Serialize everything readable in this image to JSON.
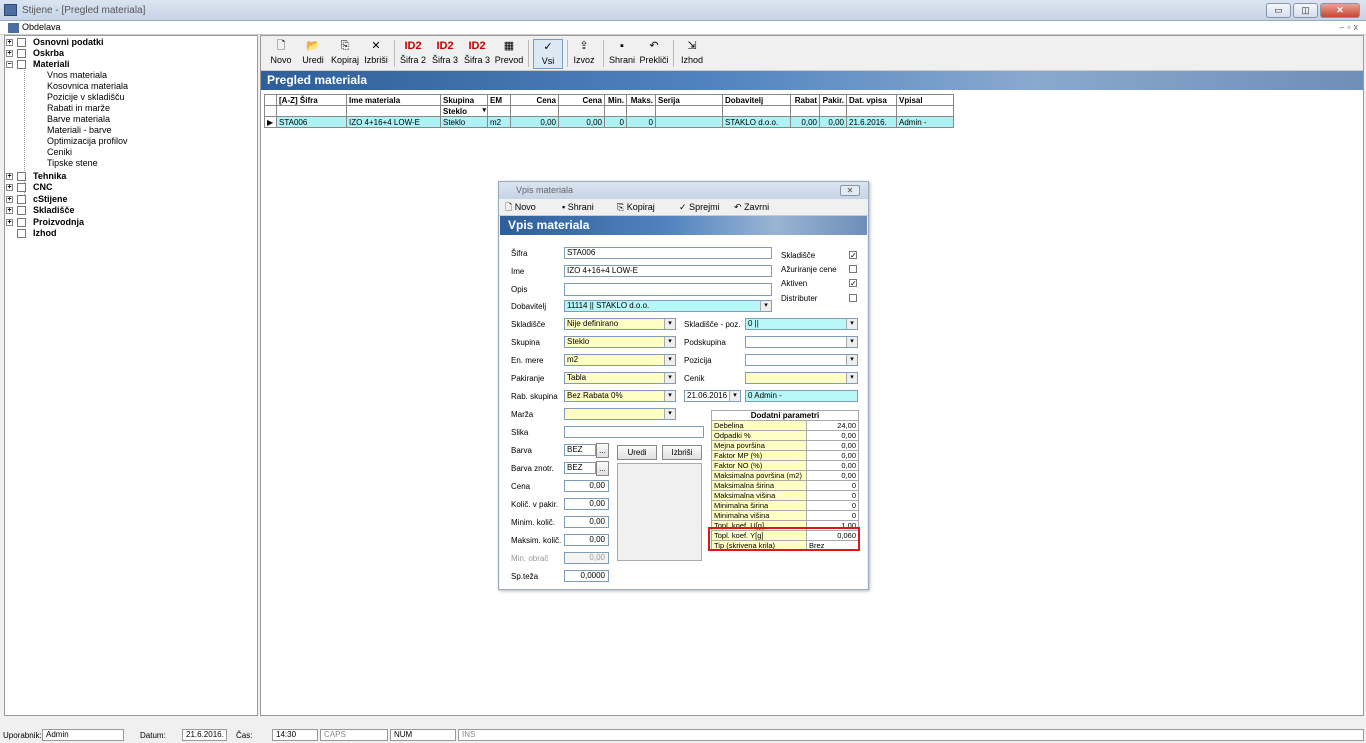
{
  "window": {
    "title": "Stijene - [Pregled materiala]",
    "min": "▭",
    "max": "◫",
    "close": "✕"
  },
  "menu": {
    "item": "Obdelava",
    "mdi_min": "–",
    "mdi_max": "▫",
    "mdi_close": "x"
  },
  "tree": {
    "top": [
      {
        "label": "Osnovni podatki",
        "expander": "+"
      },
      {
        "label": "Oskrba",
        "expander": "+"
      },
      {
        "label": "Materiali",
        "expander": "−"
      }
    ],
    "children": [
      "Vnos materiala",
      "Kosovnica materiala",
      "Pozicije v skladišču",
      "Rabati in marže",
      "Barve materiala",
      "Materiali - barve",
      "Optimizacija profilov",
      "Ceniki",
      "Tipske stene"
    ],
    "bottom": [
      {
        "label": "Tehnika",
        "expander": "+"
      },
      {
        "label": "CNC",
        "expander": "+"
      },
      {
        "label": "cStijene",
        "expander": "+"
      },
      {
        "label": "Skladišče",
        "expander": "+"
      },
      {
        "label": "Proizvodnja",
        "expander": "+"
      },
      {
        "label": "Izhod",
        "expander": ""
      }
    ]
  },
  "toolbar": [
    {
      "label": "Novo",
      "icon": "new-doc-icon",
      "glyph": "🗋"
    },
    {
      "label": "Uredi",
      "icon": "folder-edit-icon",
      "glyph": "📂"
    },
    {
      "label": "Kopiraj",
      "icon": "copy-icon",
      "glyph": "⎘"
    },
    {
      "label": "Izbriši",
      "icon": "delete-icon",
      "glyph": "✕"
    },
    {
      "label": "Šifra 2",
      "icon": "id2-icon",
      "glyph": "ID2"
    },
    {
      "label": "Šifra 3",
      "icon": "id2-icon",
      "glyph": "ID2"
    },
    {
      "label": "Šifra 3",
      "icon": "id2-icon",
      "glyph": "ID2"
    },
    {
      "label": "Prevod",
      "icon": "grid-icon",
      "glyph": "▦"
    },
    {
      "label": "Vsi",
      "icon": "checkmark-icon",
      "glyph": "✓"
    },
    {
      "label": "Izvoz",
      "icon": "export-icon",
      "glyph": "⇪"
    },
    {
      "label": "Shrani",
      "icon": "save-icon",
      "glyph": "▪"
    },
    {
      "label": "Prekliči",
      "icon": "undo-icon",
      "glyph": "↶"
    },
    {
      "label": "Izhod",
      "icon": "exit-icon",
      "glyph": "⇲"
    }
  ],
  "banner": "Pregled materiala",
  "grid": {
    "headers": [
      "[A-Z] Šifra",
      "Ime materiala",
      "Skupina",
      "EM",
      "Cena",
      "Cena",
      "Min.",
      "Maks.",
      "Serija",
      "Dobavitelj",
      "Rabat",
      "Pakir.",
      "Dat. vpisa",
      "Vpisal"
    ],
    "filter": {
      "skupina": "Steklo"
    },
    "row": [
      "STA006",
      "IZO 4+16+4 LOW-E",
      "Steklo",
      "m2",
      "0,00",
      "0,00",
      "0",
      "0",
      "",
      "STAKLO d.o.o.",
      "0,00",
      "0,00",
      "21.6.2016.",
      "Admin -"
    ],
    "indicator": "▶"
  },
  "dialog": {
    "title": "Vpis materiala",
    "close": "✕",
    "toolbar": [
      {
        "label": "Novo",
        "icon": "new-doc-icon",
        "glyph": "🗋"
      },
      {
        "label": "Shrani",
        "icon": "save-icon",
        "glyph": "▪"
      },
      {
        "label": "Kopiraj",
        "icon": "copy-icon",
        "glyph": "⎘"
      },
      {
        "label": "Sprejmi",
        "icon": "checkmark-icon",
        "glyph": "✓"
      },
      {
        "label": "Zavrni",
        "icon": "undo-icon",
        "glyph": "↶"
      }
    ],
    "banner": "Vpis materiala",
    "labels": {
      "sifra": "Šifra",
      "ime": "Ime",
      "opis": "Opis",
      "dobavitelj": "Dobavitelj",
      "skladisce": "Skladišče",
      "skupina": "Skupina",
      "enmere": "En. mere",
      "pakiranje": "Pakiranje",
      "rabsk": "Rab. skupina",
      "marza": "Marža",
      "slika": "Slika",
      "barva": "Barva",
      "barvaznotr": "Barva znotr.",
      "cena": "Cena",
      "kolicpakir": "Količ. v pakir.",
      "minkol": "Minim. količ.",
      "makskol": "Maksim. količ.",
      "minobr": "Min. obrač",
      "spteza": "Sp.teža",
      "sklpoz": "Skladišče - poz.",
      "podskupina": "Podskupina",
      "pozicija": "Pozicija",
      "cenik": "Cenik"
    },
    "values": {
      "sifra": "STA006",
      "ime": "IZO 4+16+4 LOW-E",
      "opis": "",
      "dobavitelj": "11114 || STAKLO d.o.o.",
      "skladisce": "Nije definirano",
      "skupina": "Steklo",
      "enmere": "m2",
      "pakiranje": "Tabla",
      "rabsk": "Bez Rabata 0%",
      "marza": "",
      "slika": "",
      "barva": "BEZ",
      "barvaznotr": "BEZ",
      "cena": "0,00",
      "kolicpakir": "0,00",
      "minkol": "0,00",
      "makskol": "0,00",
      "minobr": "0,00",
      "spteza": "0,0000",
      "sklpoz": "0 ||",
      "podskupina": "",
      "pozicija": "",
      "cenik": "",
      "datum": "21.06.2016",
      "vpisal": "0 Admin -"
    },
    "checks": [
      {
        "label": "Skladišče",
        "checked": "✓"
      },
      {
        "label": "Ažuriranje cene",
        "checked": ""
      },
      {
        "label": "Aktiven",
        "checked": "✓"
      },
      {
        "label": "Distributer",
        "checked": ""
      }
    ],
    "buttons": {
      "uredi": "Uredi",
      "izbrisi": "Izbriši",
      "ellipsis": "..."
    },
    "params": {
      "title": "Dodatni parametri",
      "rows": [
        [
          "Debelina",
          "24,00"
        ],
        [
          "Odpadki %",
          "0,00"
        ],
        [
          "Mejna površina",
          "0,00"
        ],
        [
          "Faktor MP (%)",
          "0,00"
        ],
        [
          "Faktor NO (%)",
          "0,00"
        ],
        [
          "Maksimalna površina (m2)",
          "0,00"
        ],
        [
          "Maksimalna širina",
          "0"
        ],
        [
          "Maksimalna višina",
          "0"
        ],
        [
          "Minimalna širina",
          "0"
        ],
        [
          "Minimalna višina",
          "0"
        ],
        [
          "Topl. koef. U[g]",
          "1,00"
        ],
        [
          "Topl. koef. Y[g]",
          "0,060"
        ],
        [
          "Tip (skrivena krila)",
          "Brez"
        ]
      ]
    }
  },
  "status": {
    "user_label": "Uporabnik:",
    "user": "Admin",
    "date_label": "Datum:",
    "date": "21.6.2016.",
    "time_label": "Čas:",
    "time": "14:30",
    "caps": "CAPS",
    "num": "NUM",
    "ins": "INS"
  }
}
